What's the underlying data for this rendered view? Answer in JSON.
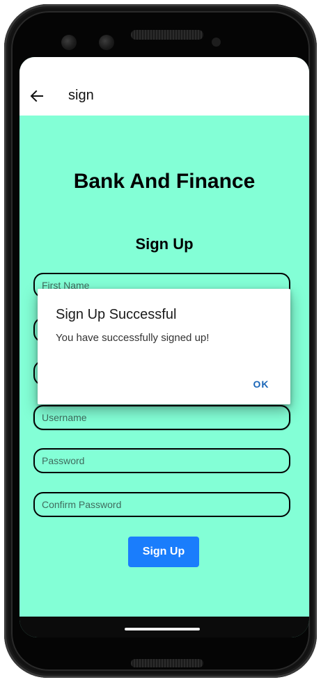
{
  "app_bar": {
    "back_icon": "arrow-left-icon",
    "title": "sign"
  },
  "main": {
    "brand_title": "Bank And Finance",
    "form_title": "Sign Up",
    "fields": [
      {
        "placeholder": "First Name",
        "value": ""
      },
      {
        "placeholder": "",
        "value": ""
      },
      {
        "placeholder": "",
        "value": ""
      },
      {
        "placeholder": "Username",
        "value": ""
      },
      {
        "placeholder": "Password",
        "value": ""
      },
      {
        "placeholder": "Confirm Password",
        "value": ""
      }
    ],
    "submit_label": "Sign Up"
  },
  "dialog": {
    "title": "Sign Up Successful",
    "message": "You have successfully signed up!",
    "ok_label": "OK"
  },
  "colors": {
    "background": "#83ffd6",
    "primary_button": "#1a7dfc",
    "dialog_action": "#1a66b8"
  }
}
